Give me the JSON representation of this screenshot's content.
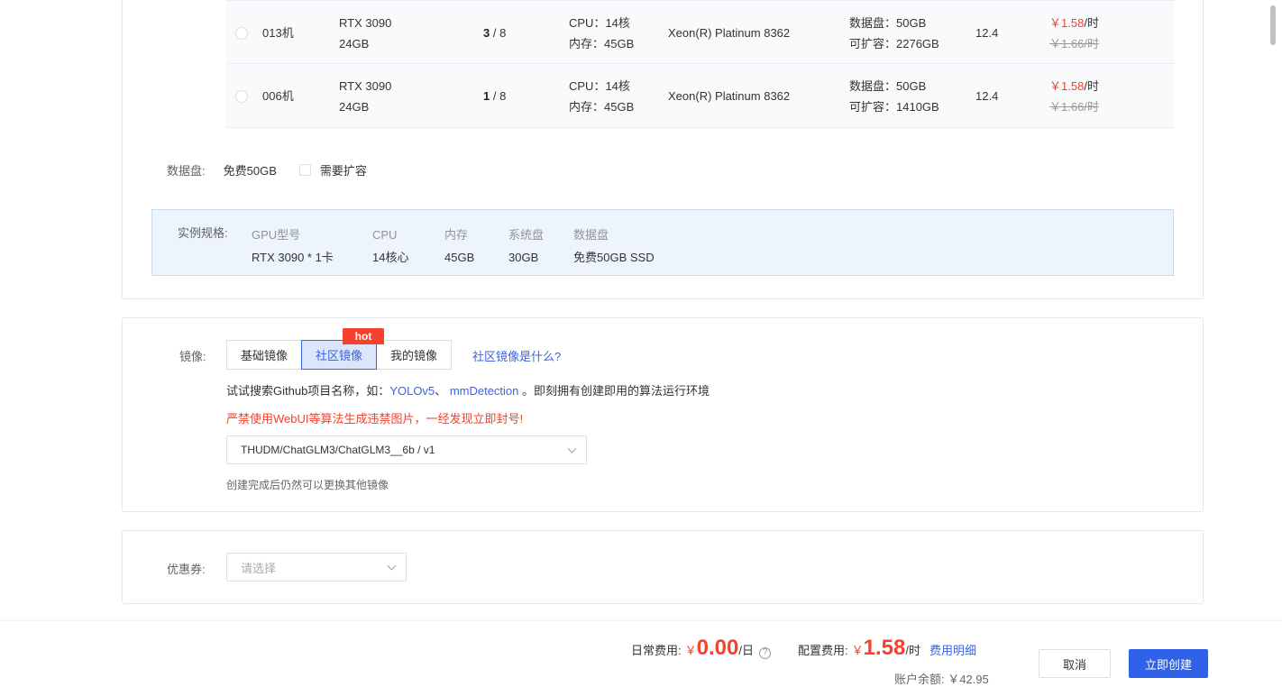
{
  "machines": [
    {
      "name": "013机",
      "gpu": "RTX 3090",
      "vram": "24GB",
      "free": "3",
      "total": " / 8",
      "cpu": "CPU：14核",
      "mem": "内存：45GB",
      "cpu_model": "Xeon(R) Platinum 8362",
      "disk": "数据盘：50GB",
      "expand": "可扩容：2276GB",
      "cuda": "12.4",
      "price": "￥1.58",
      "price_unit": "/时",
      "old_price": "￥1.66/时"
    },
    {
      "name": "006机",
      "gpu": "RTX 3090",
      "vram": "24GB",
      "free": "1",
      "total": " / 8",
      "cpu": "CPU：14核",
      "mem": "内存：45GB",
      "cpu_model": "Xeon(R) Platinum 8362",
      "disk": "数据盘：50GB",
      "expand": "可扩容：1410GB",
      "cuda": "12.4",
      "price": "￥1.58",
      "price_unit": "/时",
      "old_price": "￥1.66/时"
    }
  ],
  "data_disk": {
    "label": "数据盘:",
    "value": "免费50GB",
    "checkbox_label": "需要扩容"
  },
  "spec": {
    "label": "实例规格:",
    "columns": [
      {
        "header": "GPU型号",
        "value": "RTX 3090 * 1卡"
      },
      {
        "header": "CPU",
        "value": "14核心"
      },
      {
        "header": "内存",
        "value": "45GB"
      },
      {
        "header": "系统盘",
        "value": "30GB"
      },
      {
        "header": "数据盘",
        "value": "免费50GB SSD"
      }
    ]
  },
  "image": {
    "label": "镜像:",
    "tabs": [
      "基础镜像",
      "社区镜像",
      "我的镜像"
    ],
    "active_tab": 1,
    "hot_badge": "hot",
    "what_link": "社区镜像是什么?",
    "hint_prefix": "试试搜索Github项目名称，如：",
    "hint_link1": "YOLOv5",
    "hint_sep": "、",
    "hint_link2": "mmDetection",
    "hint_suffix": "。即刻拥有创建即用的算法运行环境",
    "warning": "严禁使用WebUI等算法生成违禁图片，一经发现立即封号!",
    "selected": "THUDM/ChatGLM3/ChatGLM3__6b / v1",
    "note": "创建完成后仍然可以更换其他镜像"
  },
  "coupon": {
    "label": "优惠券:",
    "placeholder": "请选择"
  },
  "footer": {
    "daily_label": "日常费用:",
    "daily_yen": "￥",
    "daily_amount": "0.00",
    "daily_unit": "/日",
    "help_icon": "?",
    "config_label": "配置费用:",
    "config_yen": "￥",
    "config_amount": "1.58",
    "config_unit": "/时",
    "detail_link": "费用明细",
    "balance": "账户余额: ￥42.95",
    "cancel": "取消",
    "create": "立即创建"
  },
  "colors": {
    "accent": "#3b64e0",
    "primary_button": "#2f62e8",
    "price_red": "#f5412d",
    "spec_background": "#edf4fd"
  }
}
